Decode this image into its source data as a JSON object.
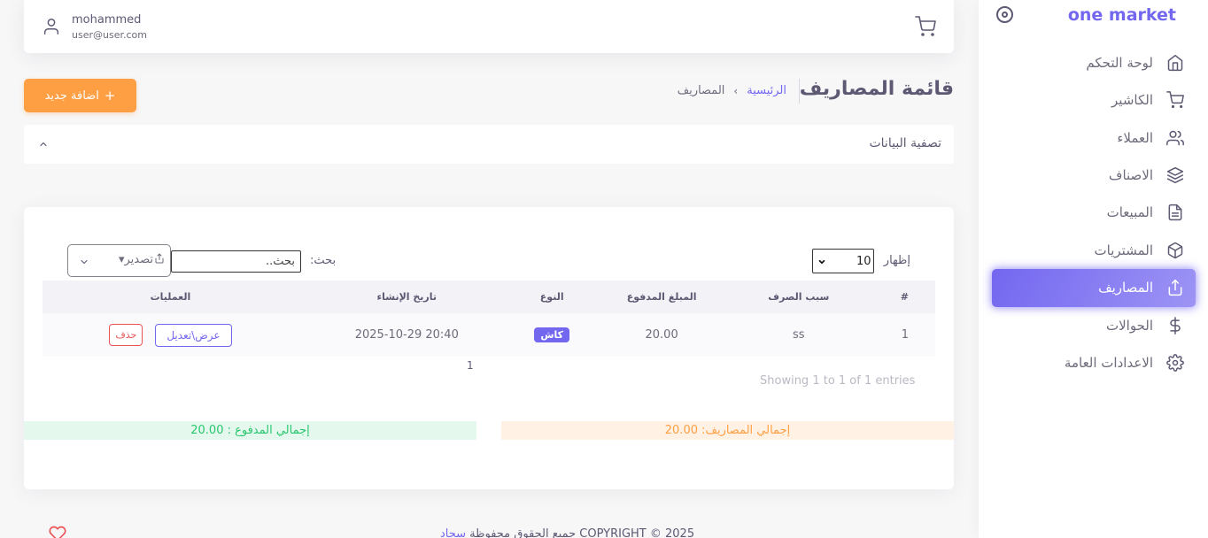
{
  "brand": {
    "name": "one market"
  },
  "sidebar": {
    "items": [
      {
        "label": "لوحة التحكم",
        "icon": "home-icon"
      },
      {
        "label": "الكاشير",
        "icon": "cart-icon"
      },
      {
        "label": "العملاء",
        "icon": "users-icon"
      },
      {
        "label": "الاصناف",
        "icon": "layers-icon"
      },
      {
        "label": "المبيعات",
        "icon": "file-text-icon"
      },
      {
        "label": "المشتريات",
        "icon": "box-icon"
      },
      {
        "label": "المصاريف",
        "icon": "upload-icon",
        "active": true
      },
      {
        "label": "الحوالات",
        "icon": "dollar-icon"
      },
      {
        "label": "الاعدادات العامة",
        "icon": "settings-icon"
      }
    ]
  },
  "navbar": {
    "user_name": "mohammed",
    "user_email": "user@user.com"
  },
  "header": {
    "title": "قائمة المصاريف",
    "breadcrumb_home": "الرئيسية",
    "breadcrumb_sep": "›",
    "breadcrumb_current": "المصاريف",
    "add_label": "اضافة جديد",
    "add_icon": "+"
  },
  "filter": {
    "title": "تصفية البيانات"
  },
  "table_controls": {
    "show_label": "إظهار",
    "page_size": "10",
    "search_label": "بحث:",
    "search_placeholder": "بحث..",
    "export_label": "تصدير▾"
  },
  "table": {
    "columns": [
      "#",
      "سبب الصرف",
      "المبلغ المدفوع",
      "النوع",
      "تاريخ الإنشاء",
      "العمليات"
    ],
    "rows": [
      {
        "id": "1",
        "reason": "ss",
        "amount": "20.00",
        "type": "كاش",
        "created": "2025-10-29 20:40",
        "edit": "عرض\\تعديل",
        "delete": "حذف"
      }
    ]
  },
  "pagination": {
    "page": "1",
    "info": "Showing 1 to 1 of 1 entries"
  },
  "totals": {
    "expenses": "إجمالي المصاريف: 20.00",
    "paid": "إجمالي المدفوع : 20.00"
  },
  "footer": {
    "text": "COPYRIGHT © 2025 جميع الحقوق محفوظة ",
    "link": "سجاد"
  },
  "colors": {
    "primary": "#7367f0",
    "warning": "#ff9f43",
    "success": "#28c76f",
    "danger": "#ea5455"
  }
}
